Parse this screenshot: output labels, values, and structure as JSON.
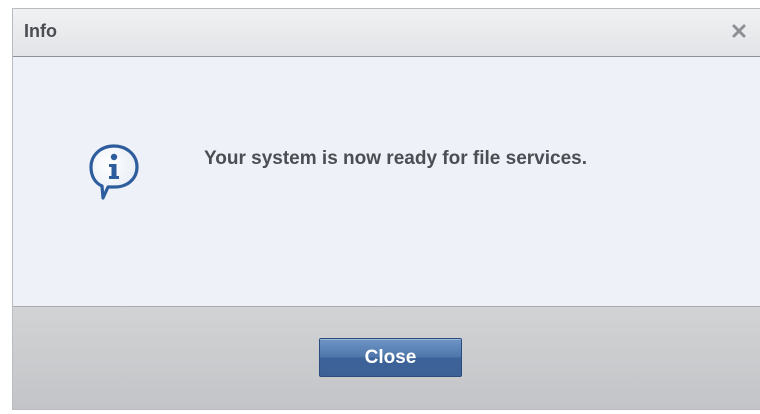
{
  "dialog": {
    "title": "Info",
    "close_icon": "close-icon",
    "info_icon": "info-speech-bubble-icon",
    "message": "Your system is now ready for file services.",
    "close_button_label": "Close"
  },
  "colors": {
    "button_blue": "#4f77aa",
    "icon_blue": "#2e5d9e",
    "body_bg": "#eef1f7",
    "footer_bg": "#c8c9cc"
  }
}
